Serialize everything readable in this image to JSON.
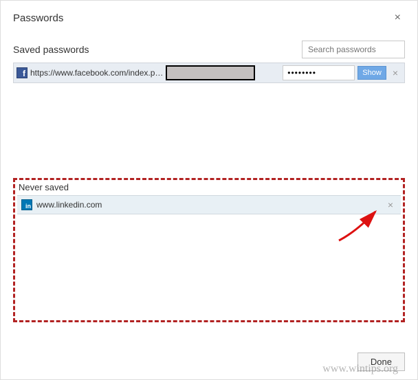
{
  "dialog": {
    "title": "Passwords"
  },
  "saved": {
    "label": "Saved passwords",
    "search_placeholder": "Search passwords",
    "rows": [
      {
        "url": "https://www.facebook.com/index.p…",
        "password_mask": "••••••••",
        "show_label": "Show"
      }
    ]
  },
  "never": {
    "label": "Never saved",
    "rows": [
      {
        "url": "www.linkedin.com"
      }
    ]
  },
  "footer": {
    "done_label": "Done"
  },
  "watermark": "www.wintips.org"
}
